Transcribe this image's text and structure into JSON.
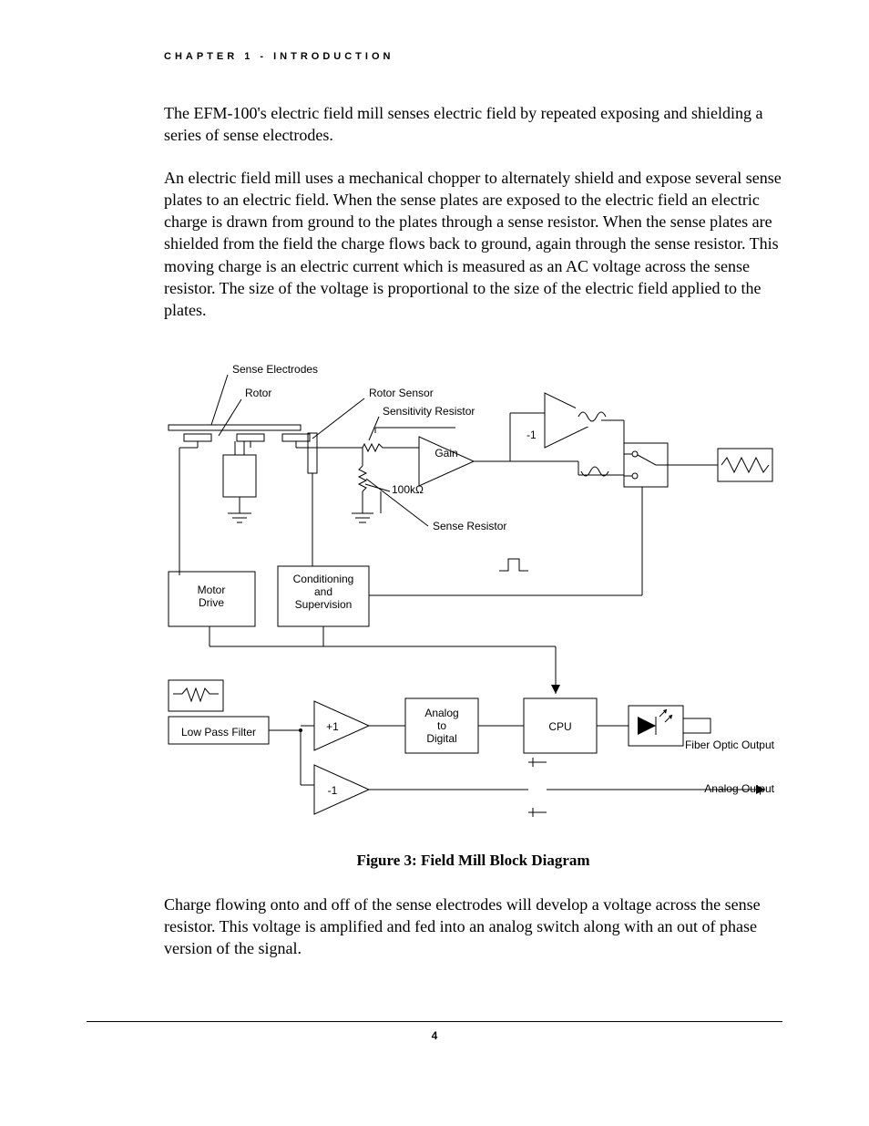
{
  "header": "CHAPTER 1 - INTRODUCTION",
  "para1": "The EFM-100's electric field mill senses electric field by repeated exposing and shielding a series of sense electrodes.",
  "para2": "An electric field mill uses a mechanical chopper to alternately shield and expose several sense plates to an electric field.  When the sense plates are exposed to the electric field an electric charge is drawn from ground to the plates through a sense resistor.  When the sense plates are shielded from the field the charge flows back to ground, again through the sense resistor.  This moving charge is an electric current which is measured as an AC voltage across the sense resistor.  The size of the voltage is proportional to the size of the electric field applied to the plates.",
  "para3": "Charge flowing onto and off of the sense electrodes will develop a voltage across the sense resistor.  This voltage is amplified and fed into an analog switch along with an out of phase version of the signal.",
  "figure": {
    "caption": "Figure 3:  Field Mill Block Diagram",
    "labels": {
      "sense_electrodes": "Sense Electrodes",
      "rotor": "Rotor",
      "rotor_sensor": "Rotor Sensor",
      "sensitivity_resistor": "Sensitivity Resistor",
      "gain": "Gain",
      "inv1": "-1",
      "r100k": "100kΩ",
      "sense_resistor": "Sense Resistor",
      "motor_drive": "Motor\nDrive",
      "conditioning": "Conditioning\nand\nSupervision",
      "low_pass": "Low Pass Filter",
      "plus1": "+1",
      "minus1": "-1",
      "adc": "Analog\nto\nDigital",
      "cpu": "CPU",
      "fiber": "Fiber Optic Output",
      "analog_out": "Analog Output"
    }
  },
  "page_number": "4"
}
